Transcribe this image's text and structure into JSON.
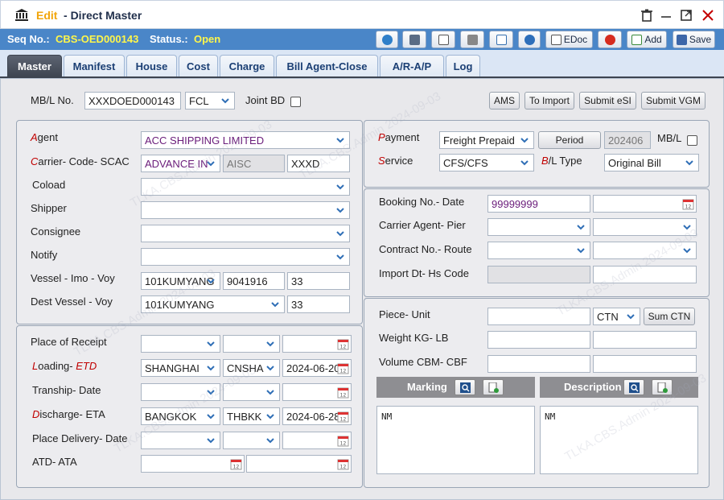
{
  "title": {
    "mode": "Edit",
    "separator": " - ",
    "name": "Direct Master"
  },
  "seq": {
    "seq_label": "Seq No.:",
    "seq_value": "CBS-OED000143",
    "status_label": "Status.:",
    "status_value": "Open"
  },
  "toolbar": {
    "edoc": "EDoc",
    "add": "Add",
    "save": "Save"
  },
  "tabs": [
    "Master",
    "Manifest",
    "House",
    "Cost",
    "Charge",
    "Bill Agent-Close",
    "A/R-A/P",
    "Log"
  ],
  "top": {
    "mbl_label": "MB/L No.",
    "mbl_value": "XXXDOED000143",
    "type_value": "FCL",
    "joint_bd_label": "Joint BD",
    "buttons": [
      "AMS",
      "To Import",
      "Submit eSI",
      "Submit VGM"
    ]
  },
  "left1": {
    "agent_first": "A",
    "agent_rest": "gent",
    "agent_value": "ACC SHIPPING LIMITED",
    "carrier_first": "C",
    "carrier_rest": "arrier- Code- SCAC",
    "carrier_value": "ADVANCE IN",
    "code_value": "AISC",
    "scac_value": "XXXD",
    "coload_label": "Coload",
    "shipper_label": "Shipper",
    "consignee_label": "Consignee",
    "notify_label": "Notify",
    "vessel_label": "Vessel - Imo - Voy",
    "vessel_value": "101KUMYANG",
    "imo_value": "9041916",
    "voy_value": "33",
    "dest_label": "Dest Vessel - Voy",
    "dest_value": "101KUMYANG",
    "dest_voy_value": "33"
  },
  "left2": {
    "receipt_label": "Place of Receipt",
    "loading_first": "L",
    "loading_rest": "oading- ",
    "loading_etd": "ETD",
    "loading_value": "SHANGHAI",
    "loading_code": "CNSHA",
    "loading_date": "2024-06-20",
    "tranship_label": "Tranship- Date",
    "discharge_first": "D",
    "discharge_rest": "ischarge- ETA",
    "discharge_value": "BANGKOK",
    "discharge_code": "THBKK",
    "discharge_date": "2024-06-28",
    "delivery_label": "Place Delivery- Date",
    "atd_label": "ATD- ATA"
  },
  "right1": {
    "payment_first": "P",
    "payment_rest": "ayment",
    "payment_value": "Freight Prepaid",
    "period_btn": "Period",
    "period_value": "202406",
    "mbl_label": "MB/L",
    "service_first": "S",
    "service_rest": "ervice",
    "service_value": "CFS/CFS",
    "bltype_first": "B",
    "bltype_rest": "/L Type",
    "bltype_value": "Original Bill"
  },
  "right2": {
    "booking_label": "Booking No.- Date",
    "booking_value": "99999999",
    "agent_pier_label": "Carrier Agent- Pier",
    "contract_label": "Contract No.- Route",
    "import_label": "Import Dt- Hs Code"
  },
  "right3": {
    "piece_label": "Piece- Unit",
    "unit_value": "CTN",
    "sum_ctn": "Sum CTN",
    "weight_label": "Weight KG- LB",
    "volume_label": "Volume CBM- CBF",
    "marking_label": "Marking",
    "description_label": "Description",
    "marking_text": "NM",
    "description_text": "NM"
  },
  "watermark": "TLKA.CBS.Admin 2024-09-03"
}
